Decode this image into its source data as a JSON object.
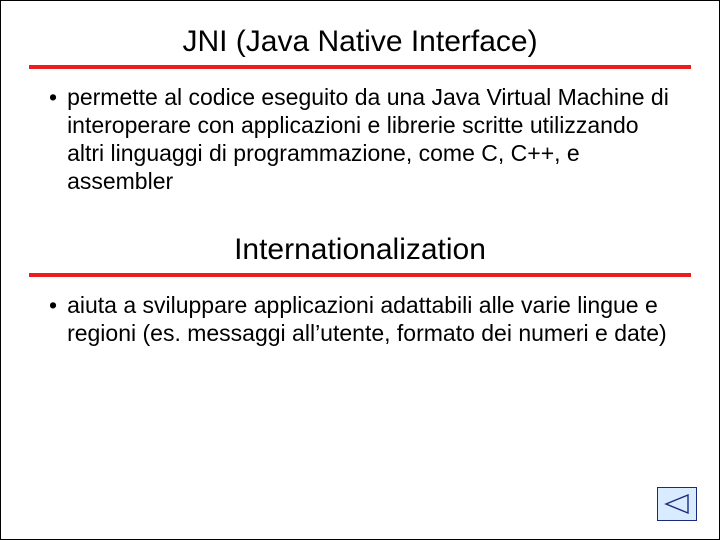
{
  "sections": [
    {
      "heading": "JNI (Java Native Interface)",
      "bullet": "permette al codice eseguito da una Java Virtual Machine di interoperare con applicazioni e librerie scritte utilizzando altri linguaggi di programmazione, come C, C++,  e assembler"
    },
    {
      "heading": "Internationalization",
      "bullet": "aiuta a sviluppare applicazioni  adattabili alle varie lingue e regioni (es. messaggi all’utente, formato dei numeri e date)"
    }
  ],
  "bullet_char": "•",
  "colors": {
    "rule": "#ee1c1c",
    "nav_border": "#1a2a7a",
    "nav_fill": "#d9ebff"
  }
}
